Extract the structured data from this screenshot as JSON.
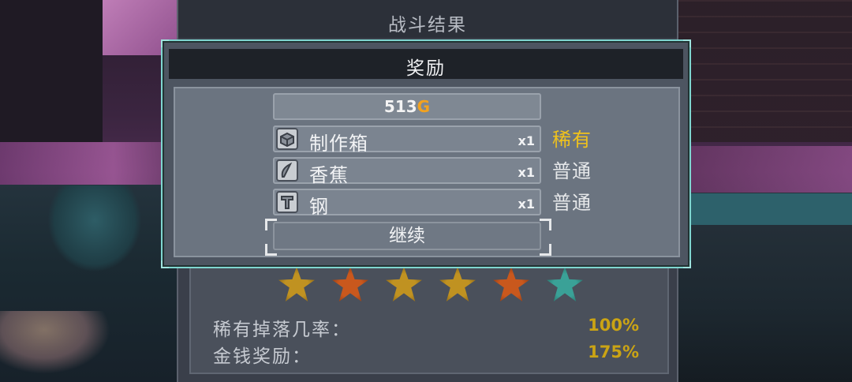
{
  "results_panel": {
    "title": "战斗结果",
    "stars": [
      {
        "color": "#c09221",
        "edge": "#6b4a10"
      },
      {
        "color": "#c9581d",
        "edge": "#6d2a0d"
      },
      {
        "color": "#c09221",
        "edge": "#6b4a10"
      },
      {
        "color": "#c09221",
        "edge": "#6b4a10"
      },
      {
        "color": "#c9581d",
        "edge": "#6d2a0d"
      },
      {
        "color": "#3aa197",
        "edge": "#1b5650"
      }
    ],
    "stats": [
      {
        "label": "稀有掉落几率：",
        "value": "100%"
      },
      {
        "label": "金钱奖励：",
        "value": "175%"
      }
    ]
  },
  "reward_modal": {
    "title": "奖励",
    "gold": {
      "amount": "513",
      "suffix": "G"
    },
    "items": [
      {
        "icon": "crafting-box-icon",
        "name": "制作箱",
        "qty": "x1",
        "rarity": "稀有",
        "rarity_color": "#f0c21c"
      },
      {
        "icon": "banana-icon",
        "name": "香蕉",
        "qty": "x1",
        "rarity": "普通",
        "rarity_color": "#e6e8ea"
      },
      {
        "icon": "steel-icon",
        "name": "钢",
        "qty": "x1",
        "rarity": "普通",
        "rarity_color": "#e6e8ea"
      }
    ],
    "continue_label": "继续"
  }
}
